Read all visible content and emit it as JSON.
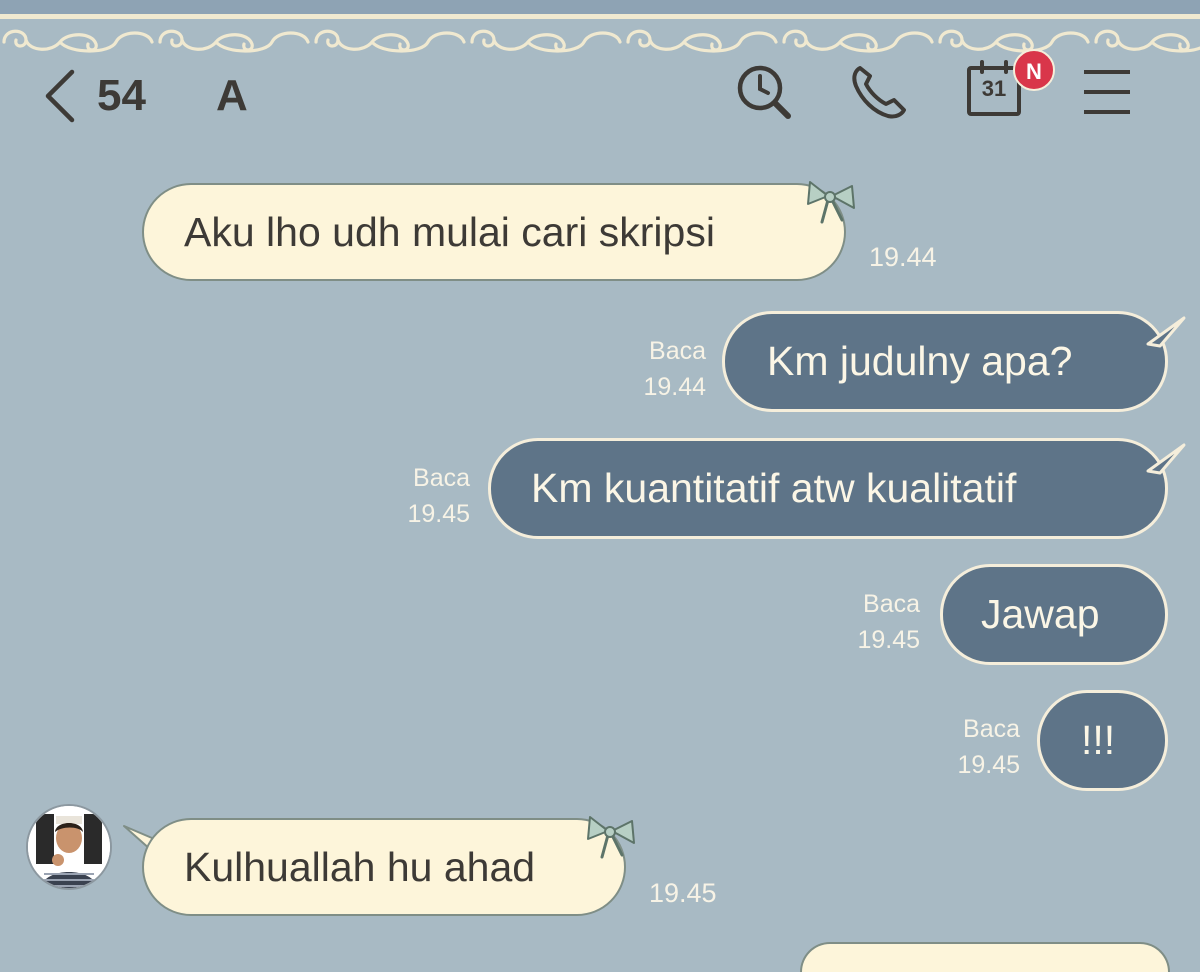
{
  "colors": {
    "background": "#a8bac4",
    "incoming_bubble": "#fdf5da",
    "outgoing_bubble": "#5e7488",
    "badge": "#d9364a"
  },
  "header": {
    "unread_count": "54",
    "chat_title": "A",
    "calendar_day": "31",
    "calendar_badge": "N",
    "icons": [
      "back-chevron-icon",
      "search-icon",
      "phone-icon",
      "calendar-icon",
      "menu-icon"
    ]
  },
  "messages": [
    {
      "direction": "incoming",
      "text": "Aku lho udh mulai cari skripsi",
      "time": "19.44"
    },
    {
      "direction": "outgoing",
      "text": "Km judulny apa?",
      "status": "Baca",
      "time": "19.44"
    },
    {
      "direction": "outgoing",
      "text": "Km kuantitatif atw kualitatif",
      "status": "Baca",
      "time": "19.45"
    },
    {
      "direction": "outgoing",
      "text": "Jawap",
      "status": "Baca",
      "time": "19.45"
    },
    {
      "direction": "outgoing",
      "text": "!!!",
      "status": "Baca",
      "time": "19.45"
    },
    {
      "direction": "incoming",
      "text": "Kulhuallah hu ahad",
      "time": "19.45"
    }
  ]
}
